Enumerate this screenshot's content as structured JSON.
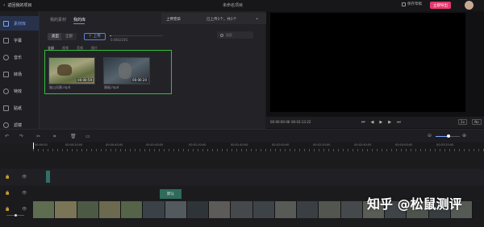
{
  "topbar": {
    "back_label": "返回我的项目",
    "title": "未命名项目",
    "save_draft": "保存草稿",
    "export": "立即导出",
    "accent": "#e8386f"
  },
  "sidebar": {
    "items": [
      {
        "label": "素材库",
        "icon": "folder-icon",
        "active": true
      },
      {
        "label": "字幕",
        "icon": "text-icon",
        "active": false
      },
      {
        "label": "音乐",
        "icon": "music-icon",
        "active": false
      },
      {
        "label": "转场",
        "icon": "transition-icon",
        "active": false
      },
      {
        "label": "特效",
        "icon": "effects-icon",
        "active": false
      },
      {
        "label": "贴纸",
        "icon": "sticker-icon",
        "active": false
      },
      {
        "label": "滤镜",
        "icon": "filter-icon",
        "active": false
      }
    ]
  },
  "media_panel": {
    "tabs": [
      "我的素材",
      "我的库"
    ],
    "active_tab": 1,
    "type_chips": [
      "类型",
      "全部"
    ],
    "upload_btn": "上传",
    "storage": "0.06G/10G",
    "search_placeholder": "搜索",
    "filter_tabs": [
      "全部",
      "视频",
      "音频",
      "图片"
    ],
    "items": [
      {
        "name": "猴山风景.mp4",
        "duration": "00:00:59"
      },
      {
        "name": "猿猴.mp4",
        "duration": "00:00:20"
      }
    ]
  },
  "upload_dropdown": {
    "label": "上传完毕",
    "status": "已上传1个，共1个"
  },
  "player": {
    "current_time": "00:00:00:00",
    "total_time": "00:03:13:22",
    "zoom": "2x",
    "extra": "No"
  },
  "timeline": {
    "ruler": [
      "00:00:00",
      "00:00:20:00",
      "00:00:40:00",
      "00:01:00:00",
      "00:01:20:00",
      "00:01:40:00",
      "00:02:00:00",
      "00:02:20:00",
      "00:02:40:00",
      "00:03:00:00",
      "00:03:20:00"
    ],
    "subtitle_clip": "默认",
    "watermark": "知乎 @松鼠测评"
  }
}
